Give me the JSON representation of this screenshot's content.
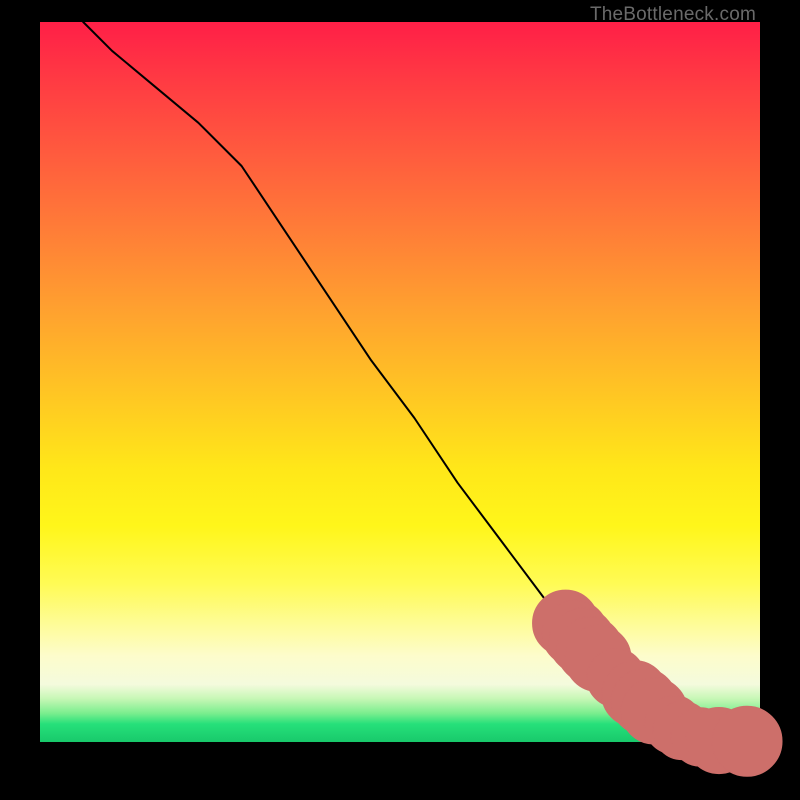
{
  "watermark": "TheBottleneck.com",
  "colors": {
    "line": "#000000",
    "marker_fill": "#cd6f6a",
    "marker_stroke": "#cd6f6a"
  },
  "chart_data": {
    "type": "line",
    "title": "",
    "xlabel": "",
    "ylabel": "",
    "xlim": [
      0,
      100
    ],
    "ylim": [
      0,
      100
    ],
    "grid": false,
    "legend": null,
    "series": [
      {
        "name": "curve",
        "x": [
          6,
          10,
          16,
          22,
          28,
          34,
          40,
          46,
          52,
          58,
          64,
          70,
          76,
          80,
          84,
          88,
          90,
          92,
          94,
          96,
          98
        ],
        "y": [
          100,
          96,
          91,
          86,
          80,
          71,
          62,
          53,
          45,
          36,
          28,
          20,
          13,
          9,
          6,
          3,
          2,
          1,
          0.3,
          0,
          0
        ]
      }
    ],
    "markers": [
      {
        "x": 73,
        "y": 16.5,
        "size": 3.4
      },
      {
        "x": 74.3,
        "y": 15.1,
        "size": 3.4
      },
      {
        "x": 75.3,
        "y": 14.0,
        "size": 3.4
      },
      {
        "x": 76.4,
        "y": 12.8,
        "size": 3.4
      },
      {
        "x": 77.5,
        "y": 11.6,
        "size": 3.4
      },
      {
        "x": 80.0,
        "y": 8.9,
        "size": 3.0
      },
      {
        "x": 82.6,
        "y": 6.7,
        "size": 3.4
      },
      {
        "x": 83.9,
        "y": 5.6,
        "size": 3.4
      },
      {
        "x": 85.3,
        "y": 4.3,
        "size": 3.4
      },
      {
        "x": 88.0,
        "y": 2.4,
        "size": 3.0
      },
      {
        "x": 89.2,
        "y": 1.6,
        "size": 3.0
      },
      {
        "x": 91.7,
        "y": 0.7,
        "size": 3.0
      },
      {
        "x": 94.3,
        "y": 0.2,
        "size": 3.4
      },
      {
        "x": 98.2,
        "y": 0.1,
        "size": 3.6
      }
    ]
  }
}
